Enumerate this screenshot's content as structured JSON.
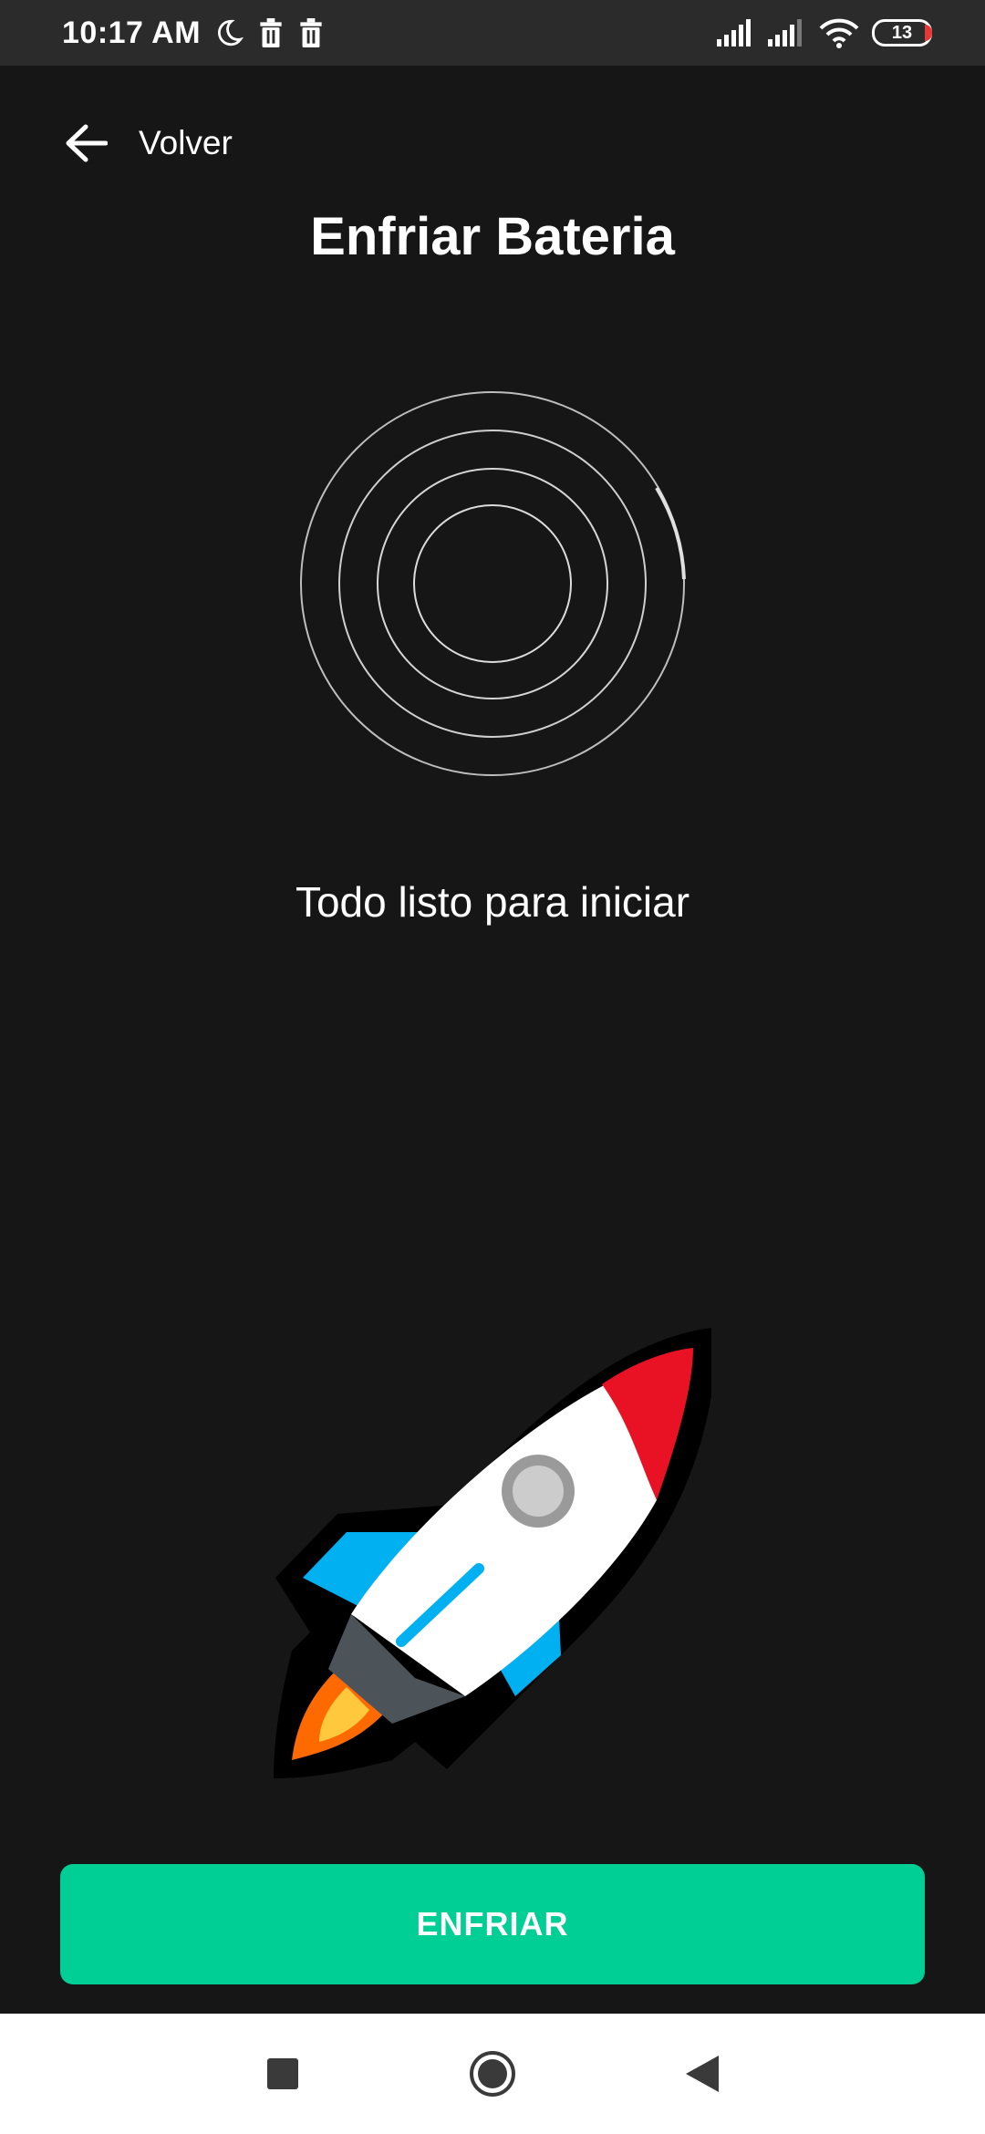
{
  "status_bar": {
    "time": "10:17 AM",
    "battery_level": "13",
    "icons": [
      "moon-icon",
      "trash-icon",
      "trash-icon",
      "signal-icon",
      "signal-icon",
      "wifi-icon",
      "battery-icon"
    ]
  },
  "header": {
    "back_label": "Volver",
    "title": "Enfriar Bateria"
  },
  "main": {
    "status_message": "Todo listo para iniciar",
    "illustration": "rocket-icon"
  },
  "action": {
    "button_label": "ENFRIAR"
  },
  "nav_bar": {
    "items": [
      "recents-square-icon",
      "home-circle-icon",
      "back-triangle-icon"
    ]
  },
  "colors": {
    "background": "#161616",
    "status_bar": "#2b2b2b",
    "accent": "#00cf95",
    "rocket_red": "#e81224",
    "rocket_blue": "#00b0f0",
    "flame_orange": "#ff6a00",
    "flame_yellow": "#ffc83d"
  }
}
